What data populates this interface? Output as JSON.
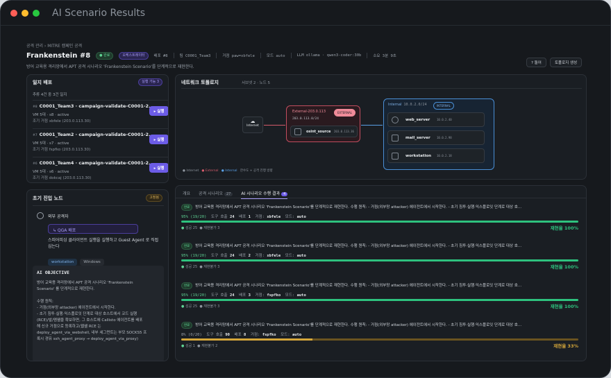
{
  "window": {
    "title": "AI Scenario Results"
  },
  "breadcrumb": "공격 관리  ›  MITRE 캠페인 공격",
  "header": {
    "name": "Frankenstein #8",
    "status": "● 완료",
    "type_badge": "오케스트레이터",
    "meta": [
      "배포 #8",
      "팀 C0001_Team3",
      "거점 paw=xbfele",
      "모드 auto",
      "LLM ollama · qwen3-coder:30b",
      "소요 3분 9초"
    ],
    "description": "방어 교육용 격리망에서 APT 공격 시나리오 'Frankenstein Scenario'를 단계적으로 재현한다.",
    "buttons": {
      "help": "? 돌어",
      "topology": "토폴로지 생성"
    }
  },
  "deployments": {
    "title": "일지 배포",
    "badge": "실행 가능 3",
    "subtitle": "추류 4건 중 3건 일지",
    "items": [
      {
        "num": "#8",
        "name": "C0001_Team3 · campaign-validate-C0001-2...",
        "info": "VM 5대 · s8 · active",
        "target": "조기 거점 xbfele (203.0.113.30)",
        "run": "▸ 실행"
      },
      {
        "num": "#7",
        "name": "C0001_Team2 · campaign-validate-C0001-2...",
        "info": "VM 5대 · s7 · active",
        "target": "조기 거점 fspfko (203.0.113.30)",
        "run": "▸ 실행"
      },
      {
        "num": "#6",
        "name": "C0001_Team4 · campaign-validate-C0001-2...",
        "info": "VM 5대 · s6 · active",
        "target": "조기 거점 dokcaj (203.0.113.30)",
        "run": "▸ 실행"
      }
    ]
  },
  "entry": {
    "title": "초기 진입 노드",
    "badge": "고정됨",
    "attacker": "외부 공격자",
    "qga": "↳ QGA 배포",
    "qga_desc": "스피어피싱 클라이언트 실행을 실행하고 Guest Agent 로 직접 심는다",
    "tags": [
      "workstation",
      "Windows"
    ],
    "objective_title": "AI OBJECTIVE",
    "objective_lines": [
      "방어 교육용 격리망에서 APT 공격 시나리오 'Frankenstein",
      "Scenario' 를 단계적으로 재현한다.",
      "",
      "수행 원칙:",
      "- 거점(외부망 attacker) 에이전트에서 시작한다.",
      "- 초기 침투·실행·익스플로잇 단계로 대상 호스트에서 코드 실행",
      "(RCE)/발/멤웰을 확보하면, 그 호스트에 Callisto 에이전트를 배포",
      "해 신규 거점으로 등록하고(웹쉘 RCE 는",
      "deploy_agent_via_webshell, 내부 세그먼트는 부모 SOCKS5 프",
      "록시 경유 ssh_agent_proxy → deploy_agent_via_proxy)"
    ]
  },
  "topology": {
    "title": "네트워크 토폴로지",
    "subtitle": "서브넷 2 · 노드 5",
    "internet": "Internet",
    "external": {
      "name": "External-203.0.113",
      "badge": "EXTERNAL",
      "cidr": "203.0.113.0/24",
      "host": "osint_source",
      "ip": "203.0.113.36"
    },
    "internal": {
      "name": "Internal",
      "cidr": "10.0.2.0/24",
      "badge": "INTERNAL",
      "hosts": [
        {
          "name": "web_server",
          "ip": "10.0.2.40"
        },
        {
          "name": "mail_server",
          "ip": "10.0.2.98"
        },
        {
          "name": "workstation",
          "ip": "10.0.2.18"
        }
      ]
    },
    "legend": [
      "● Internet",
      "● External",
      "● Internal",
      "한수도 + 공격 진행 방향"
    ]
  },
  "tabs": [
    {
      "label": "개요"
    },
    {
      "label": "공격 시나리오",
      "count": "27"
    },
    {
      "label": "AI 시나리오 수행 결과",
      "count": "4"
    }
  ],
  "results": [
    {
      "status": "완료",
      "text": "방어 교육용 격리망에서 APT 공격 시나리오 'Frankenstein Scenario'를 단계적으로 재현한다. 수행 원칙: - 거점(외부망 attacker) 에이전트에서 시작한다. - 초기 침투·실행·익스플로잇 단계로 대상 호...",
      "pct": "95% (19/20)",
      "tools": "24",
      "deploy": "1",
      "paw": "xbfele",
      "mode": "auto",
      "success": "25",
      "fail": "3",
      "rate": "재현율 100%",
      "progress": 1.0,
      "color": "#2ec27e"
    },
    {
      "status": "완료",
      "text": "방어 교육용 격리망에서 APT 공격 시나리오 'Frankenstein Scenario'를 단계적으로 재현한다. 수행 원칙: - 거점(외부망 attacker) 에이전트에서 시작한다. - 초기 침투·실행·익스플로잇 단계로 대상 호...",
      "pct": "95% (19/20)",
      "tools": "24",
      "deploy": "2",
      "paw": "xbfele",
      "mode": "auto",
      "success": "25",
      "fail": "3",
      "rate": "재현율 100%",
      "progress": 1.0,
      "color": "#2ec27e"
    },
    {
      "status": "완료",
      "text": "방어 교육용 격리망에서 APT 공격 시나리오 'Frankenstein Scenario'를 단계적으로 재현한다. 수행 원칙: - 거점(외부망 attacker) 에이전트에서 시작한다. - 초기 침투·실행·익스플로잇 단계로 대상 호...",
      "pct": "95% (19/20)",
      "tools": "24",
      "deploy": "3",
      "paw": "fspfko",
      "mode": "auto",
      "success": "25",
      "fail": "3",
      "rate": "재현율 100%",
      "progress": 1.0,
      "color": "#2ec27e"
    },
    {
      "status": "완료",
      "text": "방어 교육용 격리망에서 APT 공격 시나리오 'Frankenstein Scenario'를 단계적으로 재현한다. 수행 원칙: - 거점(외부망 attacker) 에이전트에서 시작한다. - 초기 침투·실행·익스플로잇 단계로 대상 호...",
      "pct": "8% (0/20)",
      "tools": "90",
      "deploy": "8",
      "paw": "fspfko",
      "mode": "auto",
      "success": "1",
      "fail": "2",
      "rate": "재현율 33%",
      "progress": 0.33,
      "color": "#d4a63a"
    }
  ]
}
